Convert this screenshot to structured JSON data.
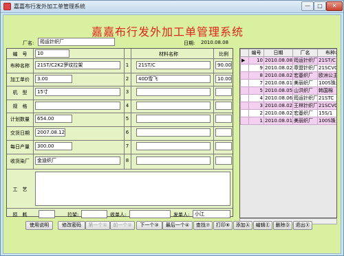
{
  "window": {
    "title": "嘉嘉布行发外加工单管理系统"
  },
  "app_title": "嘉嘉布行发外加工单管理系统",
  "header": {
    "factory_label": "厂名:",
    "factory_value": "筠运针织厂",
    "date_label": "日期:",
    "date_value": "2010.08.08"
  },
  "form": {
    "col_material": "材料名称",
    "col_ratio": "比例",
    "rows": [
      {
        "label": "编　号",
        "value": "10"
      },
      {
        "label": "布种名称",
        "value": "21ST/C2K2罗纹拉架"
      },
      {
        "label": "加工单价",
        "value": "3.00"
      },
      {
        "label": "机　型",
        "value": "15寸"
      },
      {
        "label": "规　格",
        "value": ""
      },
      {
        "label": "计划数量",
        "value": "654.00"
      },
      {
        "label": "交货日期",
        "value": "2007.08.12"
      },
      {
        "label": "每日产量",
        "value": "300.00"
      },
      {
        "label": "收货染厂",
        "value": "金迪织厂"
      }
    ],
    "materials": [
      {
        "num": "1",
        "name": "21ST/C",
        "ratio": "90.00"
      },
      {
        "num": "2",
        "name": "40D雪飞",
        "ratio": "10.00"
      },
      {
        "num": "3",
        "name": "",
        "ratio": ""
      },
      {
        "num": "4",
        "name": "",
        "ratio": ""
      },
      {
        "num": "5",
        "name": "",
        "ratio": ""
      },
      {
        "num": "6",
        "name": "",
        "ratio": ""
      },
      {
        "num": "7",
        "name": "",
        "ratio": ""
      },
      {
        "num": "8",
        "name": "",
        "ratio": ""
      }
    ],
    "craft_label": "工　艺",
    "loss_label": "损　耗",
    "loss_value": "",
    "frame_label": "拉架:",
    "frame_value": "",
    "receiver_label": "收单人:",
    "receiver_value": "",
    "sender_label": "发单人:",
    "sender_value": "小江"
  },
  "grid": {
    "headers": [
      "编号",
      "日期",
      "厂名",
      "布种名"
    ],
    "rows": [
      {
        "cells": [
          "10",
          "2010.08.08",
          "筠运针织厂",
          "21ST/C"
        ],
        "style": "pink"
      },
      {
        "cells": [
          "9",
          "2010.08.02",
          "章盟针织厂",
          "21SCVC"
        ],
        "style": "white"
      },
      {
        "cells": [
          "8",
          "2010.08.02",
          "宏基织厂",
          "欧洲公主"
        ],
        "style": "pink"
      },
      {
        "cells": [
          "7",
          "2010.08.01",
          "美丽织厂",
          "100S珠地"
        ],
        "style": "white"
      },
      {
        "cells": [
          "5",
          "2010.08.05",
          "山洪织厂",
          "韩国棉"
        ],
        "style": "pink"
      },
      {
        "cells": [
          "4",
          "2010.08.06",
          "筠运针织厂",
          "21STC"
        ],
        "style": "white"
      },
      {
        "cells": [
          "3",
          "2010.08.02",
          "王林针织厂",
          "21SCVC"
        ],
        "style": "pink"
      },
      {
        "cells": [
          "2",
          "2010.08.02",
          "宏基织厂",
          "15S/1"
        ],
        "style": "white"
      },
      {
        "cells": [
          "1",
          "2010.08.01",
          "美丽织厂",
          "100S珠"
        ],
        "style": "pink"
      }
    ]
  },
  "toolbar": {
    "help": "使用说明",
    "change_password": "修改密码",
    "first": "第一个①",
    "prev": "前一个②",
    "next": "下一个③",
    "last": "最后一个④",
    "find": "查找⑦",
    "print": "打印⑧",
    "add": "添加Ⓐ",
    "edit": "编辑Ⓔ",
    "delete": "删除Ⓓ",
    "exit": "退出Ⓧ"
  },
  "colors": {
    "title": "#e0241e",
    "client_bg": "#d8f0a0",
    "grid_pink": "#f4d0f0"
  }
}
